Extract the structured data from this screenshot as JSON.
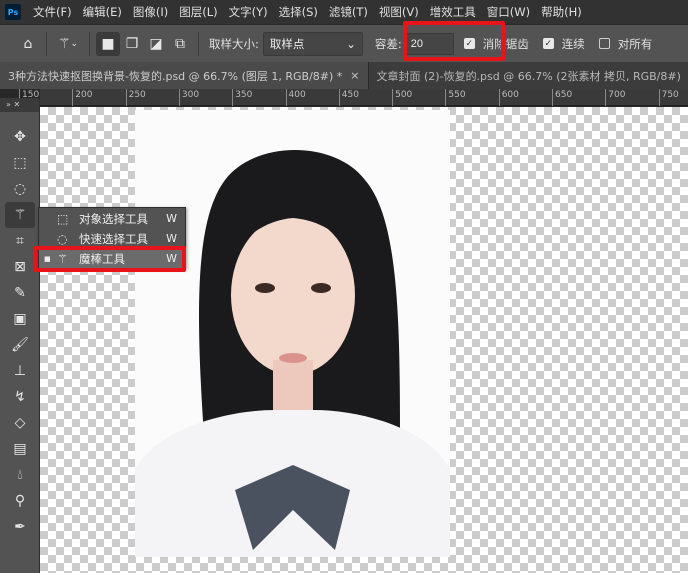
{
  "menubar": {
    "logo": "Ps",
    "items": [
      "文件(F)",
      "编辑(E)",
      "图像(I)",
      "图层(L)",
      "文字(Y)",
      "选择(S)",
      "滤镜(T)",
      "视图(V)",
      "增效工具",
      "窗口(W)",
      "帮助(H)"
    ]
  },
  "options": {
    "sample_size_label": "取样大小:",
    "sample_size_value": "取样点",
    "tolerance_label": "容差:",
    "tolerance_value": "20",
    "anti_alias_label": "消除锯齿",
    "anti_alias_checked": true,
    "contiguous_label": "连续",
    "contiguous_checked": true,
    "sample_all_label": "对所有",
    "sample_all_checked": false
  },
  "tabs": [
    {
      "label": "3种方法快速抠图换背景-恢复的.psd @ 66.7% (图层 1, RGB/8#) *",
      "close": "×"
    },
    {
      "label": "文章封面 (2)-恢复的.psd @ 66.7% (2张素材 拷贝, RGB/8#)"
    }
  ],
  "ruler": [
    "150",
    "200",
    "250",
    "300",
    "350",
    "400",
    "450",
    "500",
    "550",
    "600",
    "650",
    "700",
    "750"
  ],
  "flyout": {
    "items": [
      {
        "label": "对象选择工具",
        "key": "W"
      },
      {
        "label": "快速选择工具",
        "key": "W"
      },
      {
        "label": "魔棒工具",
        "key": "W",
        "selected": true
      }
    ]
  },
  "colors": {
    "highlight": "#e8141a"
  }
}
